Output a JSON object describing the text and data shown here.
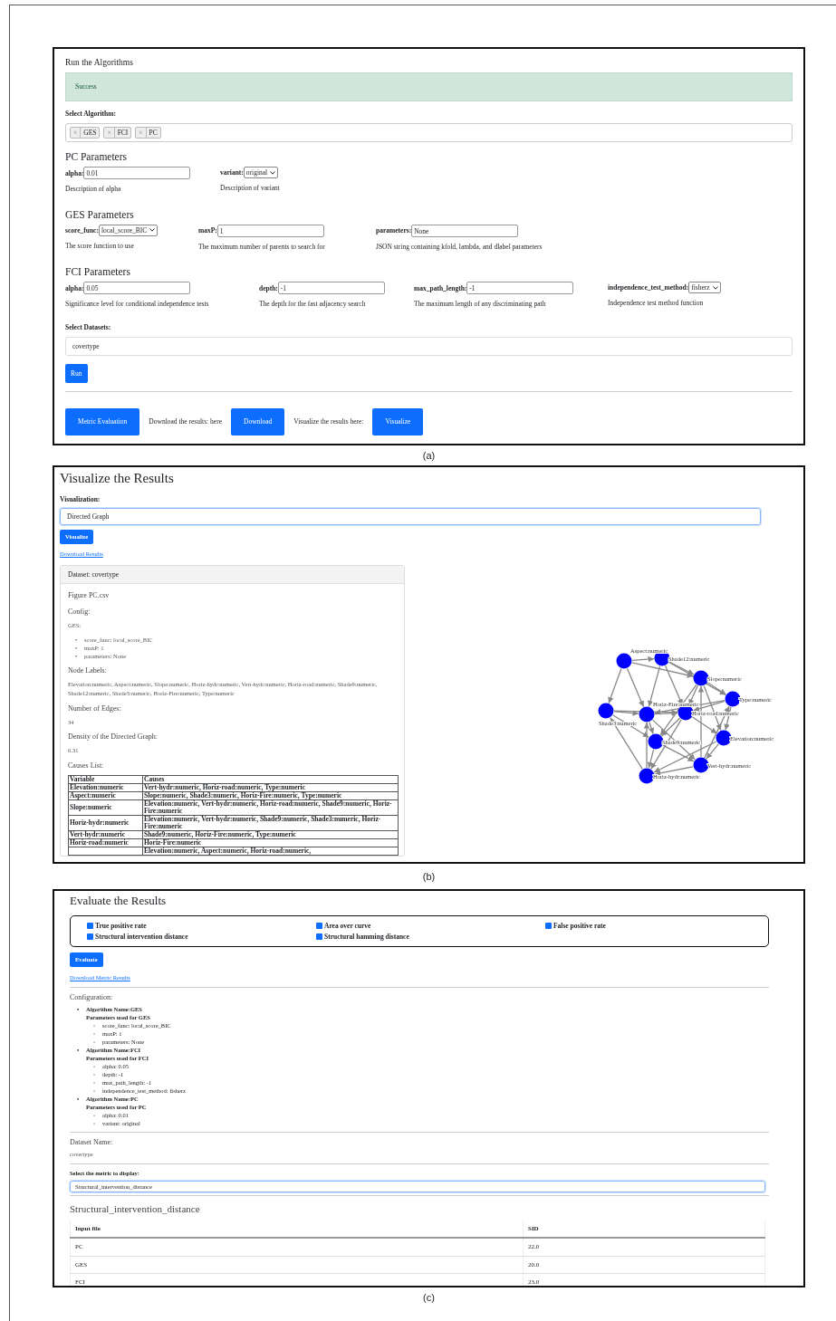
{
  "run_panel": {
    "title": "Run the Algorithms",
    "alert": "Success",
    "algorithm_label": "Select Algorithm:",
    "algorithms": [
      {
        "remove": "×",
        "label": "GES"
      },
      {
        "remove": "×",
        "label": "FCI"
      },
      {
        "remove": "×",
        "label": "PC"
      }
    ],
    "param_groups": [
      {
        "title": "PC Parameters",
        "params": [
          {
            "kind": "input",
            "label": "alpha:",
            "value": "0.01",
            "description": "Description of alpha"
          },
          {
            "kind": "select",
            "label": "variant:",
            "value": "original",
            "description": "Description of variant"
          }
        ]
      },
      {
        "title": "GES Parameters",
        "params": [
          {
            "kind": "select",
            "label": "score_func:",
            "value": "local_score_BIC",
            "description": "The score function to use"
          },
          {
            "kind": "input",
            "label": "maxP:",
            "value": "1",
            "description": "The maximum number of parents to search for"
          },
          {
            "kind": "input",
            "label": "parameters:",
            "value": "None",
            "description": "JSON string containing kfold, lambda, and dlabel parameters"
          }
        ]
      },
      {
        "title": "FCI Parameters",
        "params": [
          {
            "kind": "input",
            "label": "alpha:",
            "value": "0.05",
            "description": "Significance level for conditional independence tests"
          },
          {
            "kind": "input",
            "label": "depth:",
            "value": "-1",
            "description": "The depth for the fast adjacency search"
          },
          {
            "kind": "input",
            "label": "max_path_length:",
            "value": "-1",
            "description": "The maximum length of any discriminating path"
          },
          {
            "kind": "select",
            "label": "independence_test_method:",
            "value": "fisherz",
            "description": "Independence test method function"
          }
        ]
      }
    ],
    "datasets_label": "Select Datasets:",
    "dataset": "covertype",
    "run_button": "Run",
    "footer": [
      {
        "kind": "button",
        "text": "Metric Evaluation"
      },
      {
        "kind": "text",
        "text": "Download the results: here"
      },
      {
        "kind": "button",
        "text": "Download"
      },
      {
        "kind": "text",
        "text": "Visualize the results here:"
      },
      {
        "kind": "button",
        "text": "Visualize"
      }
    ]
  },
  "visualize_panel": {
    "title": "Visualize the Results",
    "visualization_label": "Visualization:",
    "visualization": "Directed Graph",
    "visualize_button": "Visualize",
    "download_link": "Download Results",
    "card": {
      "header": "Dataset: covertype",
      "figure": "Figure PC.csv",
      "config_heading": "Config:",
      "algorithm": "GES:",
      "bullet": "•",
      "config_items": [
        "score_func: local_score_BIC",
        "maxP: 1",
        "parameters: None"
      ],
      "node_labels_heading": "Node Labels:",
      "node_labels": "Elevation:numeric, Aspect:numeric, Slope:numeric, Horiz-hydr:numeric, Vert-hydr:numeric, Horiz-road:numeric, Shade9:numeric, Shade12:numeric, Shade3:numeric, Horiz-Fire:numeric, Type:numeric",
      "edges_heading": "Number of Edges:",
      "edges": "34",
      "density_heading": "Density of the Directed Graph:",
      "density": "0.31",
      "causes_heading": "Causes List:",
      "causes_columns": [
        "Variable",
        "Causes"
      ],
      "causes_rows": [
        {
          "variable": "Elevation:numeric",
          "causes": "Vert-hydr:numeric, Horiz-road:numeric, Type:numeric"
        },
        {
          "variable": "Aspect:numeric",
          "causes": "Slope:numeric, Shade3:numeric, Horiz-Fire:numeric, Type:numeric"
        },
        {
          "variable": "Slope:numeric",
          "causes": "Elevation:numeric, Vert-hydr:numeric, Horiz-road:numeric, Shade9:numeric, Horiz-Fire:numeric"
        },
        {
          "variable": "Horiz-hydr:numeric",
          "causes": "Elevation:numeric, Vert-hydr:numeric, Shade9:numeric, Shade3:numeric, Horiz-Fire:numeric"
        },
        {
          "variable": "Vert-hydr:numeric",
          "causes": "Shade9:numeric, Horiz-Fire:numeric, Type:numeric"
        },
        {
          "variable": "Horiz-road:numeric",
          "causes": "Horiz-Fire:numeric"
        },
        {
          "causes": "Elevation:numeric, Aspect:numeric, Horiz-road:numeric,"
        }
      ]
    },
    "graph_nodes": [
      {
        "label": "Aspect:numeric"
      },
      {
        "label": "Shade12:numeric"
      },
      {
        "label": "Slope:numeric"
      },
      {
        "label": "Type:numeric"
      },
      {
        "label": "Shade3:numeric"
      },
      {
        "label": "Horiz-Fire:numeric"
      },
      {
        "label": "Horiz-road:numeric"
      },
      {
        "label": "Elevation:numeric"
      },
      {
        "label": "Shade9:numeric"
      },
      {
        "label": "Vert-hydr:numeric"
      },
      {
        "label": "Horiz-hydr:numeric"
      }
    ]
  },
  "evaluate_panel": {
    "title": "Evaluate the Results",
    "metrics": [
      {
        "label": "True positive rate",
        "checked": true
      },
      {
        "label": "Area over curve",
        "checked": true
      },
      {
        "label": "False positive rate",
        "checked": true
      },
      {
        "label": "Structural intervention distance",
        "checked": true
      },
      {
        "label": "Structural hamming distance",
        "checked": true
      }
    ],
    "evaluate_button": "Evaluate",
    "download_link": "Download Metric Results",
    "configuration_heading": "Configuration:",
    "bullet": "•",
    "sub_bullet": "◦",
    "configuration": [
      {
        "name": "Algorithm Name:GES",
        "params_heading": "Parameters used for GES",
        "params": [
          "score_func: local_score_BIC",
          "maxP: 1",
          "parameters: None"
        ]
      },
      {
        "name": "Algorithm Name:FCI",
        "params_heading": "Parameters used for FCI",
        "params": [
          "alpha: 0.05",
          "depth: -1",
          "max_path_length: -1",
          "independence_test_method: fisherz"
        ]
      },
      {
        "name": "Algorithm Name:PC",
        "params_heading": "Parameters used for PC",
        "params": [
          "alpha: 0.01",
          "variant: original"
        ]
      }
    ],
    "dataset_heading": "Dataset Name:",
    "dataset": "covertype",
    "metric_label": "Select the metric to display:",
    "metric": "Structural_intervention_distance",
    "result_heading": "Structural_intervention_distance",
    "columns": [
      "Input file",
      "SID"
    ],
    "rows": [
      [
        "PC",
        "22.0"
      ],
      [
        "GES",
        "20.0"
      ],
      [
        "FCI",
        "23.0"
      ]
    ]
  },
  "captions": [
    "(a)",
    "(b)",
    "(c)"
  ]
}
